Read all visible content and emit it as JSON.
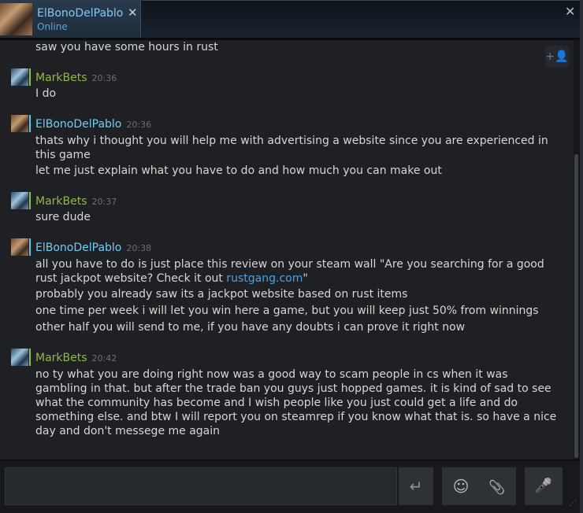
{
  "tab": {
    "name": "ElBonoDelPablo",
    "status": "Online",
    "close": "✕"
  },
  "window": {
    "close": "✕"
  },
  "chat": {
    "first_line": "saw you have some hours in rust",
    "messages": [
      {
        "sender": "MarkBets",
        "time": "20:36",
        "lines": [
          "I do"
        ]
      },
      {
        "sender": "ElBonoDelPablo",
        "time": "20:36",
        "lines": [
          "thats why i thought you will help me with advertising a website since you are experienced in this game",
          "let me just explain what you have to do and how much you can make out"
        ]
      },
      {
        "sender": "MarkBets",
        "time": "20:37",
        "lines": [
          "sure dude"
        ]
      },
      {
        "sender": "ElBonoDelPablo",
        "time": "20:38",
        "lines": [
          "all you have to do is just place this review on your steam wall \"Are you searching for a good rust jackpot website? Check it out ",
          "rustgang.com",
          "\"",
          "probably you already saw its a jackpot website based on rust items",
          "one time per week i will let you win here a game, but you will keep just 50% from winnings",
          "other half you will send to me, if you have any doubts i can prove it right now"
        ]
      },
      {
        "sender": "MarkBets",
        "time": "20:42",
        "lines": [
          "no ty what you are doing right now was a good way to scam people in cs when it was gambling in that. but after the trade ban you guys just hopped games. it is kind of sad to see what the community has become and I wish people like you just could get a life and do something else. and btw I will report you on steamrep if you know what that is. so have a nice day and don't messege me again"
        ]
      }
    ]
  },
  "input": {
    "value": "",
    "send_icon": "↵"
  },
  "tools": {
    "emoji_icon": "☺",
    "attach_icon": "📎",
    "voice_icon": "🎤",
    "add_friend_icon": "+👤"
  },
  "colors": {
    "friend_online": "#6dcff6",
    "self_name": "#90ba3c",
    "link": "#4aa3df",
    "background": "#1e2024"
  }
}
